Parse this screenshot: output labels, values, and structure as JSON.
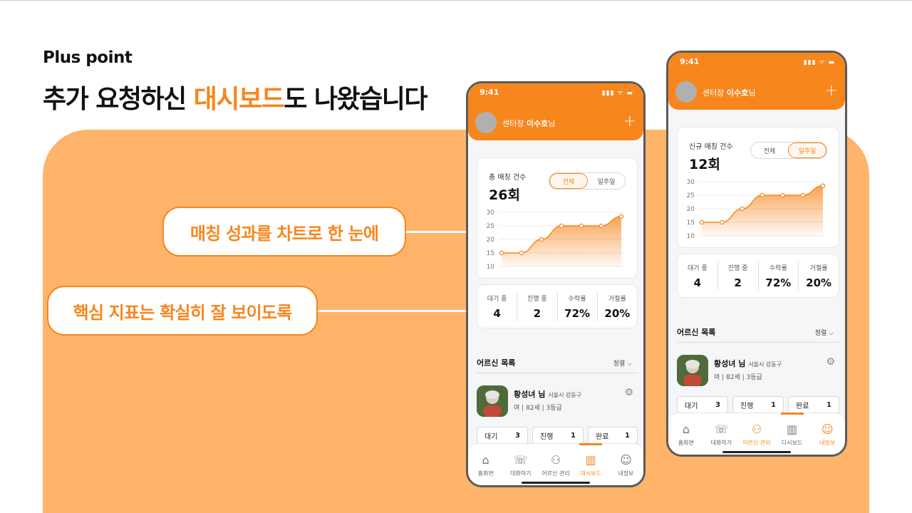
{
  "slide": {
    "kicker": "Plus point",
    "headline_pre": "추가 요청하신 ",
    "headline_highlight": "대시보드",
    "headline_post": "도 나왔습니다",
    "accent_color": "#f7861d",
    "panel_color": "#ffb46a"
  },
  "callouts": {
    "first": "매칭 성과를 차트로 한 눈에",
    "second": "핵심 지표는 확실히 잘 보이도록"
  },
  "phone_a": {
    "time": "9:41",
    "status": "▮▮▮ ᯤ ▬",
    "greeting_role": "센터장 ",
    "greeting_name": "이수호",
    "greeting_suffix": "님",
    "plus": "+",
    "chart_label": "총 매칭 건수",
    "chart_total": "26회",
    "seg_all": "전체",
    "seg_week": "일주일",
    "metrics": [
      {
        "label": "대기 중",
        "value": "4"
      },
      {
        "label": "진행 중",
        "value": "2"
      },
      {
        "label": "수락률",
        "value": "72%"
      },
      {
        "label": "거절률",
        "value": "20%"
      }
    ],
    "list_title": "어르신 목록",
    "sort_label": "정렬 ⌵",
    "elder_name": "황성녀 님",
    "elder_location": "서울시 강동구",
    "elder_meta": "여 | 82세 | 3등급",
    "stats": [
      {
        "label": "대기",
        "value": "3"
      },
      {
        "label": "진행",
        "value": "1"
      },
      {
        "label": "완료",
        "value": "1"
      }
    ],
    "tabs": [
      {
        "icon": "⌂",
        "label": "홈화면"
      },
      {
        "icon": "☏",
        "label": "대화하기"
      },
      {
        "icon": "⚇",
        "label": "어르신 관리"
      },
      {
        "icon": "▥",
        "label": "대시보드"
      },
      {
        "icon": "☺",
        "label": "내정보"
      }
    ]
  },
  "phone_b": {
    "time": "9:41",
    "status": "▮▮▮ ᯤ ▬",
    "greeting_role": "센터장 ",
    "greeting_name": "이수호",
    "greeting_suffix": "님",
    "plus": "+",
    "chart_label": "신규 매칭 건수",
    "chart_total": "12회",
    "seg_all": "전체",
    "seg_week": "일주일",
    "metrics": [
      {
        "label": "대기 중",
        "value": "4"
      },
      {
        "label": "진행 중",
        "value": "2"
      },
      {
        "label": "수락률",
        "value": "72%"
      },
      {
        "label": "거절률",
        "value": "20%"
      }
    ],
    "list_title": "어르신 목록",
    "sort_label": "정렬 ⌵",
    "elder_name": "황성녀 님",
    "elder_location": "서울시 강동구",
    "elder_meta": "여 | 82세 | 3등급",
    "stats": [
      {
        "label": "대기",
        "value": "3"
      },
      {
        "label": "진행",
        "value": "1"
      },
      {
        "label": "완료",
        "value": "1"
      }
    ],
    "tabs": [
      {
        "icon": "⌂",
        "label": "홈화면"
      },
      {
        "icon": "☏",
        "label": "대화하기"
      },
      {
        "icon": "⚇",
        "label": "어르신 관리"
      },
      {
        "icon": "▥",
        "label": "다시보드"
      },
      {
        "icon": "☺",
        "label": "내정보"
      }
    ]
  },
  "chart_data": [
    {
      "type": "area",
      "title": "총 매칭 건수",
      "x": [
        1,
        2,
        3,
        4,
        5,
        6,
        7
      ],
      "values": [
        15,
        15,
        20,
        25,
        25,
        25,
        28.5
      ],
      "yticks": [
        "30",
        "25",
        "20",
        "15",
        "10"
      ],
      "ylim": [
        10,
        30
      ],
      "grid": true,
      "color": "#f7861d"
    },
    {
      "type": "area",
      "title": "신규 매칭 건수",
      "x": [
        1,
        2,
        3,
        4,
        5,
        6,
        7
      ],
      "values": [
        15,
        15,
        20,
        25,
        25,
        25,
        28.5
      ],
      "yticks": [
        "30",
        "25",
        "20",
        "15",
        "10"
      ],
      "ylim": [
        10,
        30
      ],
      "grid": true,
      "color": "#f7861d"
    }
  ]
}
